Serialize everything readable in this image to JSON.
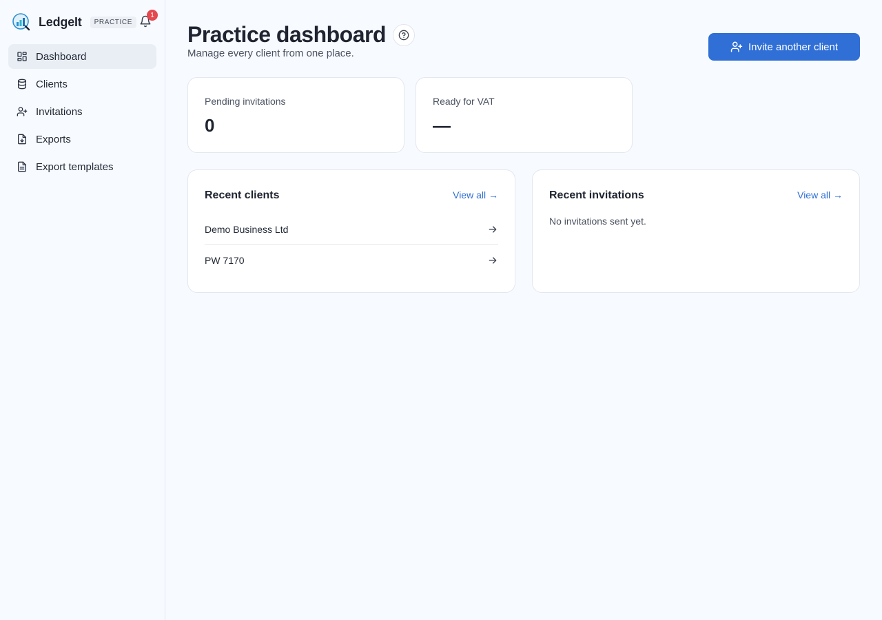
{
  "brand": {
    "name": "LedgeIt",
    "badge": "PRACTICE",
    "notification_count": "1"
  },
  "sidebar": {
    "items": [
      {
        "label": "Dashboard",
        "icon": "dashboard-icon",
        "active": true
      },
      {
        "label": "Clients",
        "icon": "database-icon"
      },
      {
        "label": "Invitations",
        "icon": "user-plus-icon"
      },
      {
        "label": "Exports",
        "icon": "file-download-icon"
      },
      {
        "label": "Export templates",
        "icon": "file-text-icon"
      }
    ]
  },
  "header": {
    "title": "Practice dashboard",
    "subtitle": "Manage every client from one place.",
    "invite_label": "Invite another client"
  },
  "stats": [
    {
      "label": "Pending invitations",
      "value": "0"
    },
    {
      "label": "Ready for VAT",
      "value": "—"
    }
  ],
  "recent_clients": {
    "title": "Recent clients",
    "link": "View all →",
    "items": [
      {
        "name": "Demo Business Ltd"
      },
      {
        "name": "PW 7170"
      }
    ]
  },
  "recent_invitations": {
    "title": "Recent invitations",
    "link": "View all →",
    "empty": "No invitations sent yet."
  },
  "colors": {
    "accent": "#2f6fd6",
    "background": "#f7faff",
    "alert": "#e5484d"
  }
}
